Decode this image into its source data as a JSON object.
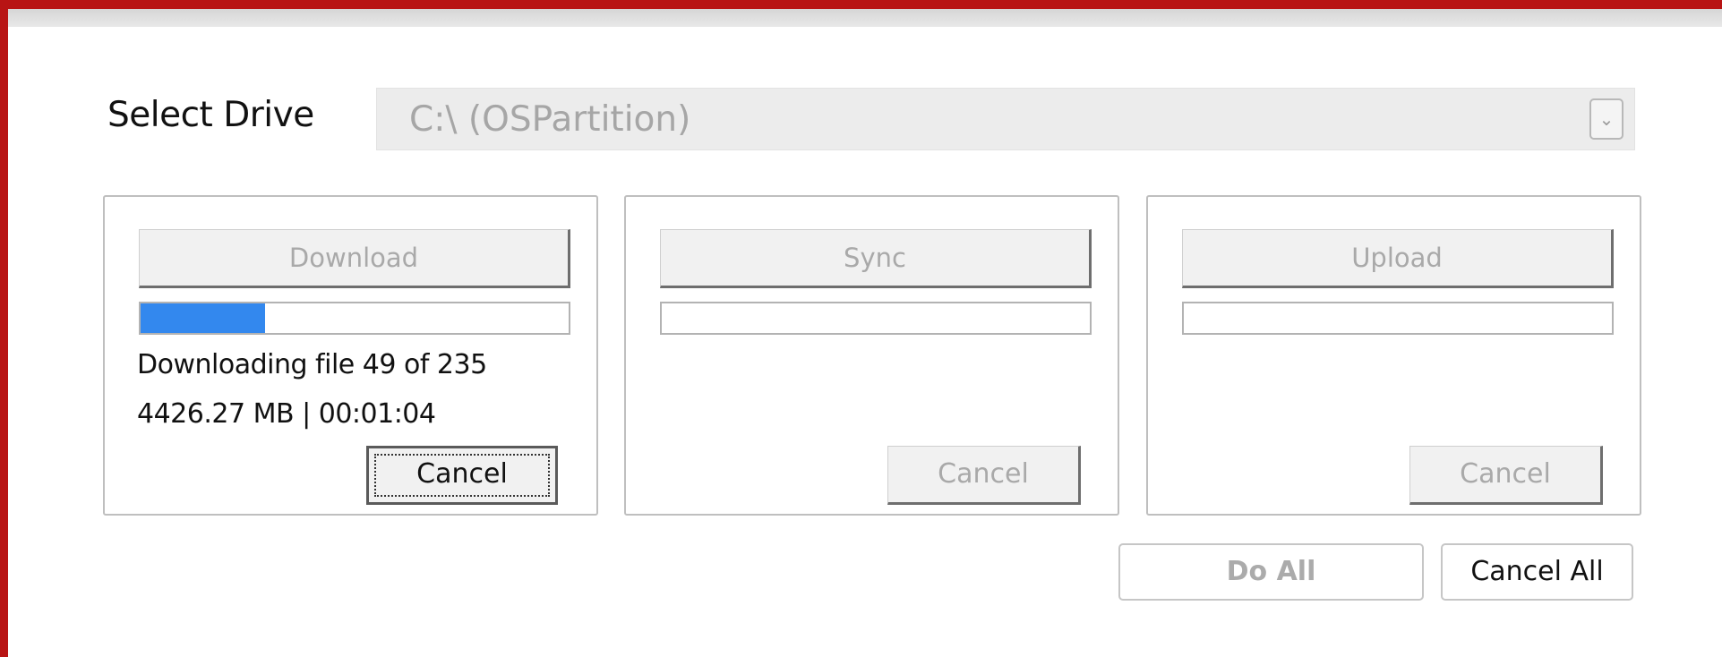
{
  "drive": {
    "label": "Select Drive",
    "value": "C:\\ (OSPartition)"
  },
  "panels": [
    {
      "action_label": "Download",
      "progress": 0.29,
      "status_line_1": "Downloading file 49 of 235",
      "status_line_2": "4426.27 MB | 00:01:04",
      "cancel_label": "Cancel"
    },
    {
      "action_label": "Sync",
      "progress": 0,
      "cancel_label": "Cancel"
    },
    {
      "action_label": "Upload",
      "progress": 0,
      "cancel_label": "Cancel"
    }
  ],
  "footer": {
    "do_all_label": "Do All",
    "cancel_all_label": "Cancel All"
  },
  "colors": {
    "window_border": "#b81414",
    "progress_fill": "#3388ee"
  }
}
